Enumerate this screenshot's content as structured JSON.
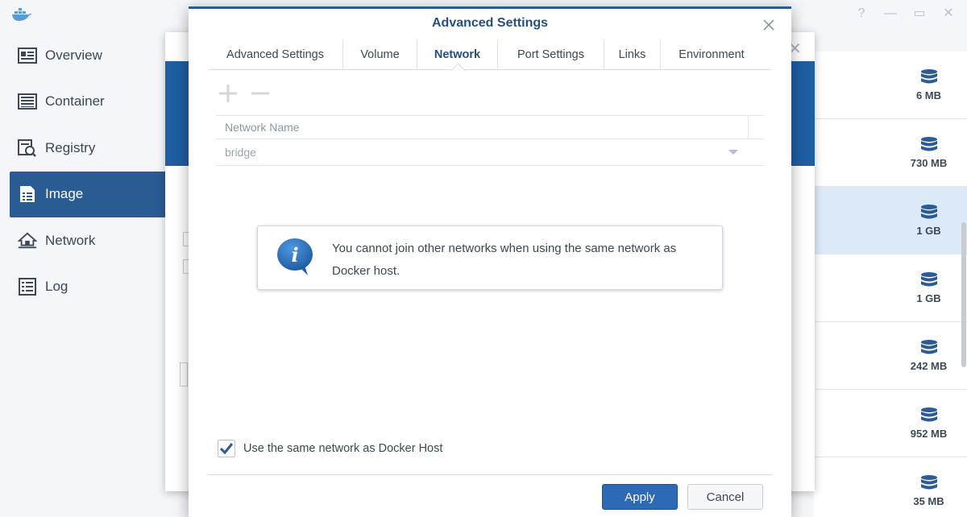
{
  "sidebar": {
    "items": [
      {
        "label": "Overview",
        "icon": "overview-icon"
      },
      {
        "label": "Container",
        "icon": "container-icon"
      },
      {
        "label": "Registry",
        "icon": "registry-icon"
      },
      {
        "label": "Image",
        "icon": "image-icon",
        "active": true
      },
      {
        "label": "Network",
        "icon": "network-icon"
      },
      {
        "label": "Log",
        "icon": "log-icon"
      }
    ]
  },
  "image_list": {
    "rows": [
      {
        "size": "6 MB"
      },
      {
        "size": "730 MB"
      },
      {
        "size": "1 GB",
        "selected": true
      },
      {
        "size": "1 GB"
      },
      {
        "size": "242 MB"
      },
      {
        "size": "952 MB"
      },
      {
        "size": "35 MB"
      }
    ]
  },
  "modal": {
    "title": "Advanced Settings",
    "tabs": [
      {
        "label": "Advanced Settings"
      },
      {
        "label": "Volume"
      },
      {
        "label": "Network",
        "active": true
      },
      {
        "label": "Port Settings"
      },
      {
        "label": "Links"
      },
      {
        "label": "Environment"
      }
    ],
    "table": {
      "header": "Network Name",
      "rows": [
        {
          "name": "bridge"
        }
      ]
    },
    "info_message": "You cannot join other networks when using the same network as Docker host.",
    "checkbox": {
      "label": "Use the same network as Docker Host",
      "checked": true
    },
    "apply_label": "Apply",
    "cancel_label": "Cancel"
  },
  "colors": {
    "accent": "#2a5b93",
    "primary_button": "#2d6ab5",
    "selected_row": "#dce9f7"
  }
}
